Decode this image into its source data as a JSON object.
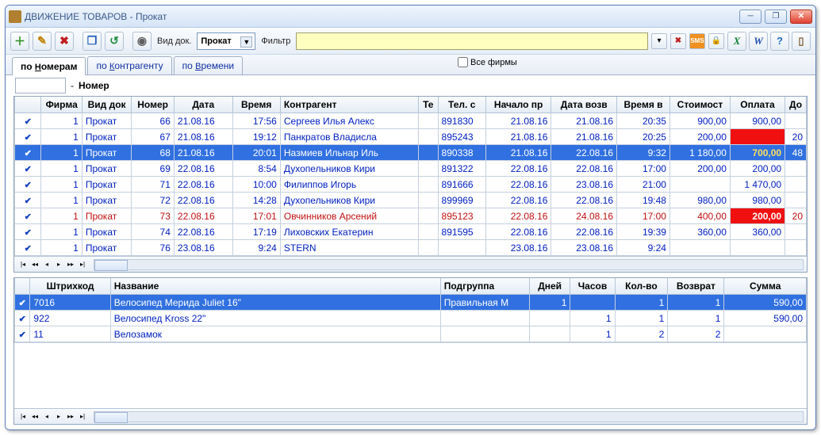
{
  "window": {
    "title": "ДВИЖЕНИЕ ТОВАРОВ - Прокат"
  },
  "toolbar": {
    "docTypeLabel": "Вид док.",
    "docTypeValue": "Прокат",
    "filterLabel": "Фильтр",
    "allFirmsLabel": "Все фирмы"
  },
  "tabs": {
    "t1": "по Номерам",
    "t1u": "Н",
    "t2": "по Контрагенту",
    "t2u": "К",
    "t3": "по Времени",
    "t3u": "В"
  },
  "sub": {
    "label": "Номер"
  },
  "mainHeaders": {
    "c0": "",
    "c1": "Фирма",
    "c2": "Вид док",
    "c3": "Номер",
    "c4": "Дата",
    "c5": "Время",
    "c6": "Контрагент",
    "c7": "Те",
    "c8": "Тел. с",
    "c9": "Начало пр",
    "c10": "Дата возв",
    "c11": "Время в",
    "c12": "Стоимост",
    "c13": "Оплата",
    "c14": "До"
  },
  "rows": [
    {
      "firm": "1",
      "type": "Прокат",
      "num": "66",
      "date": "21.08.16",
      "time": "17:56",
      "contr": "Сергеев Илья Алекс",
      "tel": "",
      "tels": "891830",
      "start": "21.08.16",
      "ret": "21.08.16",
      "rtime": "20:35",
      "cost": "900,00",
      "pay": "900,00",
      "d": ""
    },
    {
      "firm": "1",
      "type": "Прокат",
      "num": "67",
      "date": "21.08.16",
      "time": "19:12",
      "contr": "Панкратов Владисла",
      "tel": "",
      "tels": "895243",
      "start": "21.08.16",
      "ret": "21.08.16",
      "rtime": "20:25",
      "cost": "200,00",
      "pay": "",
      "d": "20",
      "payred": true
    },
    {
      "firm": "1",
      "type": "Прокат",
      "num": "68",
      "date": "21.08.16",
      "time": "20:01",
      "contr": "Назмиев Ильнар Иль",
      "tel": "",
      "tels": "890338",
      "start": "21.08.16",
      "ret": "22.08.16",
      "rtime": "9:32",
      "cost": "1 180,00",
      "pay": "700,00",
      "d": "48",
      "sel": true,
      "payyellow": true
    },
    {
      "firm": "1",
      "type": "Прокат",
      "num": "69",
      "date": "22.08.16",
      "time": "8:54",
      "contr": "Духопельников Кири",
      "tel": "",
      "tels": "891322",
      "start": "22.08.16",
      "ret": "22.08.16",
      "rtime": "17:00",
      "cost": "200,00",
      "pay": "200,00",
      "d": ""
    },
    {
      "firm": "1",
      "type": "Прокат",
      "num": "71",
      "date": "22.08.16",
      "time": "10:00",
      "contr": "Филиппов Игорь",
      "tel": "",
      "tels": "891666",
      "start": "22.08.16",
      "ret": "23.08.16",
      "rtime": "21:00",
      "cost": "",
      "pay": "1 470,00",
      "d": ""
    },
    {
      "firm": "1",
      "type": "Прокат",
      "num": "72",
      "date": "22.08.16",
      "time": "14:28",
      "contr": "Духопельников Кири",
      "tel": "",
      "tels": "899969",
      "start": "22.08.16",
      "ret": "22.08.16",
      "rtime": "19:48",
      "cost": "980,00",
      "pay": "980,00",
      "d": ""
    },
    {
      "firm": "1",
      "type": "Прокат",
      "num": "73",
      "date": "22.08.16",
      "time": "17:01",
      "contr": "Овчинников Арсений",
      "tel": "",
      "tels": "895123",
      "start": "22.08.16",
      "ret": "24.08.16",
      "rtime": "17:00",
      "cost": "400,00",
      "pay": "200,00",
      "d": "20",
      "red": true,
      "payred": true
    },
    {
      "firm": "1",
      "type": "Прокат",
      "num": "74",
      "date": "22.08.16",
      "time": "17:19",
      "contr": "Лиховских Екатерин",
      "tel": "",
      "tels": "891595",
      "start": "22.08.16",
      "ret": "22.08.16",
      "rtime": "19:39",
      "cost": "360,00",
      "pay": "360,00",
      "d": ""
    },
    {
      "firm": "1",
      "type": "Прокат",
      "num": "76",
      "date": "23.08.16",
      "time": "9:24",
      "contr": "STERN",
      "tel": "",
      "tels": "",
      "start": "23.08.16",
      "ret": "23.08.16",
      "rtime": "9:24",
      "cost": "",
      "pay": "",
      "d": ""
    }
  ],
  "detailHeaders": {
    "c0": "",
    "c1": "Штрихкод",
    "c2": "Название",
    "c3": "Подгруппа",
    "c4": "Дней",
    "c5": "Часов",
    "c6": "Кол-во",
    "c7": "Возврат",
    "c8": "Сумма"
  },
  "details": [
    {
      "code": "7016",
      "name": "Велосипед Мерида Juliet 16\"",
      "sub": "Правильная М",
      "days": "1",
      "hours": "",
      "qty": "1",
      "ret": "1",
      "sum": "590,00",
      "sel": true
    },
    {
      "code": "922",
      "name": "Велосипед Kross 22\"",
      "sub": "",
      "days": "",
      "hours": "1",
      "qty": "1",
      "ret": "1",
      "sum": "590,00"
    },
    {
      "code": "11",
      "name": "Велозамок",
      "sub": "",
      "days": "",
      "hours": "1",
      "qty": "2",
      "ret": "2",
      "sum": ""
    }
  ]
}
